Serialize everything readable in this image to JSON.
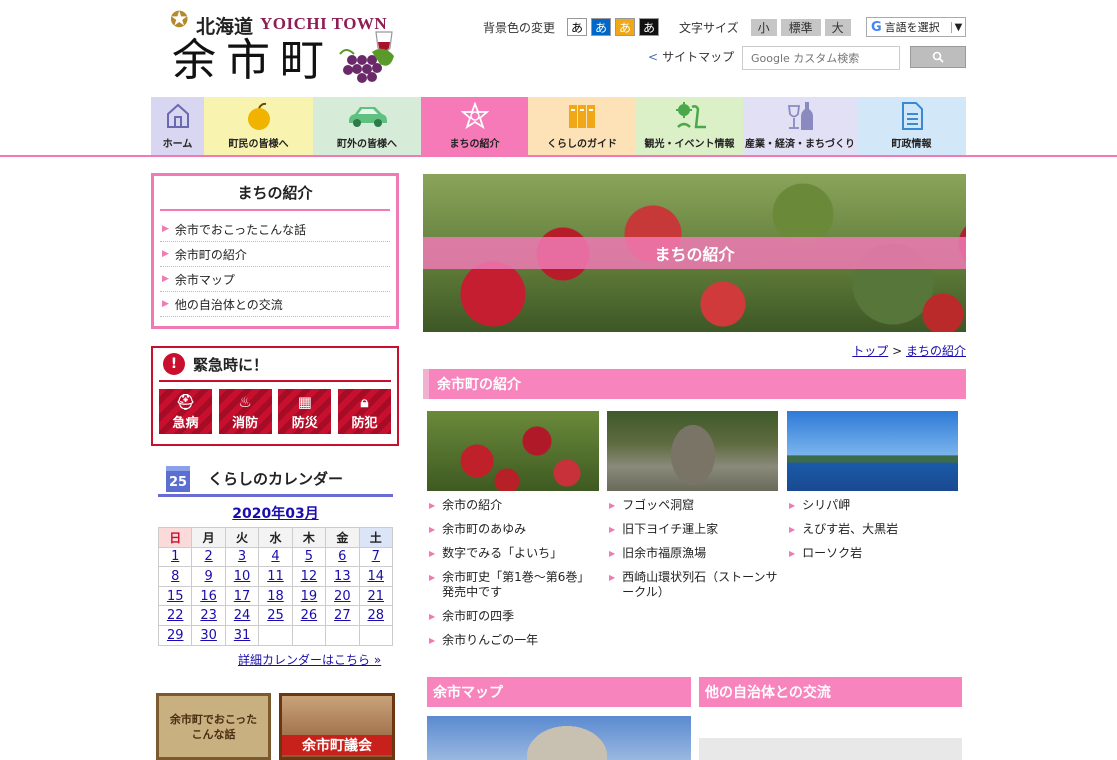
{
  "header": {
    "logo": {
      "pref": "北海道",
      "english": "YOICHI TOWN",
      "town": "余市町"
    },
    "bg_change_label": "背景色の変更",
    "bg_buttons": [
      {
        "label": "あ",
        "bg": "#ffffff",
        "fg": "#000000"
      },
      {
        "label": "あ",
        "bg": "#0068c8",
        "fg": "#ffffff"
      },
      {
        "label": "あ",
        "bg": "#f0a818",
        "fg": "#ffffff"
      },
      {
        "label": "あ",
        "bg": "#111111",
        "fg": "#ffffff"
      }
    ],
    "font_size_label": "文字サイズ",
    "font_sizes": [
      "小",
      "標準",
      "大"
    ],
    "language_label": "言語を選択",
    "sitemap_label": "サイトマップ",
    "search_placeholder": "Google カスタム検索",
    "search_icon": "search-icon"
  },
  "nav": [
    {
      "label": "ホーム",
      "icon": "home-icon",
      "bg": "#d8d6f0"
    },
    {
      "label": "町民の皆様へ",
      "icon": "apple-icon",
      "bg": "#f8f4b0"
    },
    {
      "label": "町外の皆様へ",
      "icon": "car-icon",
      "bg": "#d6ecd8"
    },
    {
      "label": "まちの紹介",
      "icon": "emblem-icon",
      "bg": "#f77ab8"
    },
    {
      "label": "くらしのガイド",
      "icon": "book-icon",
      "bg": "#fde2b8"
    },
    {
      "label": "観光・イベント情報",
      "icon": "sightseeing-icon",
      "bg": "#dcf0c8"
    },
    {
      "label": "産業・経済・まちづくり",
      "icon": "wine-icon",
      "bg": "#e2e0f4"
    },
    {
      "label": "町政情報",
      "icon": "document-icon",
      "bg": "#d2e8f8"
    }
  ],
  "sidebar": {
    "title": "まちの紹介",
    "items": [
      "余市でおこったこんな話",
      "余市町の紹介",
      "余市マップ",
      "他の自治体との交流"
    ]
  },
  "emergency": {
    "title": "緊急時に！",
    "buttons": [
      {
        "label": "急病",
        "icon": "ambulance-icon"
      },
      {
        "label": "消防",
        "icon": "fire-icon"
      },
      {
        "label": "防災",
        "icon": "wall-icon"
      },
      {
        "label": "防犯",
        "icon": "lock-icon"
      }
    ]
  },
  "calendar": {
    "icon_day": "25",
    "title": "くらしのカレンダー",
    "month": "2020年03月",
    "weekdays": [
      "日",
      "月",
      "火",
      "水",
      "木",
      "金",
      "土"
    ],
    "weeks": [
      [
        "1",
        "2",
        "3",
        "4",
        "5",
        "6",
        "7"
      ],
      [
        "8",
        "9",
        "10",
        "11",
        "12",
        "13",
        "14"
      ],
      [
        "15",
        "16",
        "17",
        "18",
        "19",
        "20",
        "21"
      ],
      [
        "22",
        "23",
        "24",
        "25",
        "26",
        "27",
        "28"
      ],
      [
        "29",
        "30",
        "31",
        "",
        "",
        "",
        ""
      ]
    ],
    "more_link": "詳細カレンダーはこちら »"
  },
  "banners": {
    "story": "余市町でおこった\nこんな話",
    "council": "余市町議会"
  },
  "hero": {
    "title": "まちの紹介"
  },
  "breadcrumb": {
    "top": "トップ",
    "sep": ">",
    "current": "まちの紹介"
  },
  "intro": {
    "title": "余市町の紹介",
    "col1": [
      "余市の紹介",
      "余市町のあゆみ",
      "数字でみる「よいち」",
      "余市町史「第1巻〜第6巻」発売中です",
      "余市町の四季",
      "余市りんごの一年"
    ],
    "col2": [
      "フゴッペ洞窟",
      "旧下ヨイチ運上家",
      "旧余市福原漁場",
      "西崎山環状列石（ストーンサークル）"
    ],
    "col3": [
      "シリパ岬",
      "えびす岩、大黒岩",
      "ローソク岩"
    ]
  },
  "sections": {
    "map": "余市マップ",
    "exchange": "他の自治体との交流"
  }
}
